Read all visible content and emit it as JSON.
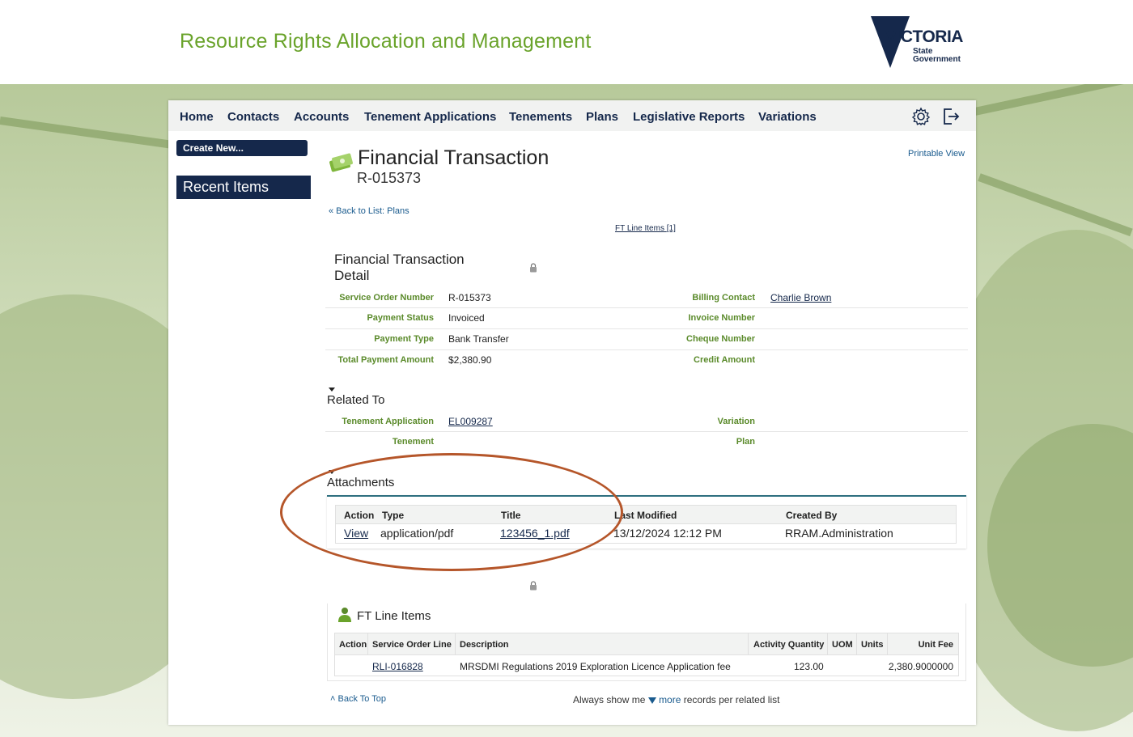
{
  "header": {
    "app_title": "Resource Rights Allocation and Management",
    "logo_word": "VICTORIA",
    "logo_sub1": "State",
    "logo_sub2": "Government"
  },
  "nav": {
    "items": [
      "Home",
      "Contacts",
      "Accounts",
      "Tenement Applications",
      "Tenements",
      "Plans",
      "Legislative Reports",
      "Variations"
    ],
    "icons": [
      "gear-icon",
      "logout-icon"
    ]
  },
  "sidebar": {
    "create_new": "Create New...",
    "recent_items": "Recent Items"
  },
  "page": {
    "title": "Financial Transaction",
    "record_number": "R-015373",
    "printable_view": "Printable View",
    "back_to_list": "« Back to List: Plans",
    "ft_line_items_link": "FT Line Items",
    "ft_line_items_count": "[1]"
  },
  "detail": {
    "section_title_line1": "Financial Transaction",
    "section_title_line2": "Detail",
    "left": [
      {
        "label": "Service Order Number",
        "value": "R-015373"
      },
      {
        "label": "Payment Status",
        "value": "Invoiced"
      },
      {
        "label": "Payment Type",
        "value": "Bank Transfer"
      },
      {
        "label": "Total Payment Amount",
        "value": "$2,380.90"
      }
    ],
    "right": [
      {
        "label": "Billing Contact",
        "value": "Charlie Brown"
      },
      {
        "label": "Invoice Number",
        "value": ""
      },
      {
        "label": "Cheque Number",
        "value": ""
      },
      {
        "label": "Credit Amount",
        "value": ""
      }
    ]
  },
  "related": {
    "section_title": "Related To",
    "left": [
      {
        "label": "Tenement Application",
        "value": "EL009287"
      },
      {
        "label": "Tenement",
        "value": ""
      }
    ],
    "right": [
      {
        "label": "Variation",
        "value": ""
      },
      {
        "label": "Plan",
        "value": ""
      }
    ]
  },
  "attachments": {
    "section_title": "Attachments",
    "columns": [
      "Action",
      "Type",
      "Title",
      "Last Modified",
      "Created By"
    ],
    "rows": [
      {
        "action": "View",
        "type": "application/pdf",
        "title": "123456_1.pdf",
        "last_modified": "13/12/2024 12:12 PM",
        "created_by": "RRAM.Administration"
      }
    ]
  },
  "ft_line_items": {
    "section_title": "FT Line Items",
    "columns": [
      "Action",
      "Service Order Line",
      "Description",
      "Activity Quantity",
      "UOM",
      "Units",
      "Unit Fee"
    ],
    "rows": [
      {
        "action": "",
        "service_order_line": "RLI-016828",
        "description": "MRSDMI Regulations 2019 Exploration Licence Application fee",
        "activity_quantity": "123.00",
        "uom": "",
        "units": "",
        "unit_fee": "2,380.9000000"
      }
    ]
  },
  "footer": {
    "back_to_top": "Back To Top",
    "always_show_prefix": "Always show me",
    "more_label": "more",
    "always_show_suffix": "records per related list"
  },
  "colors": {
    "brand_navy": "#15284b",
    "title_green": "#6aa32b",
    "label_green": "#5a8a2a",
    "annotation_oval": "#b5562a"
  }
}
